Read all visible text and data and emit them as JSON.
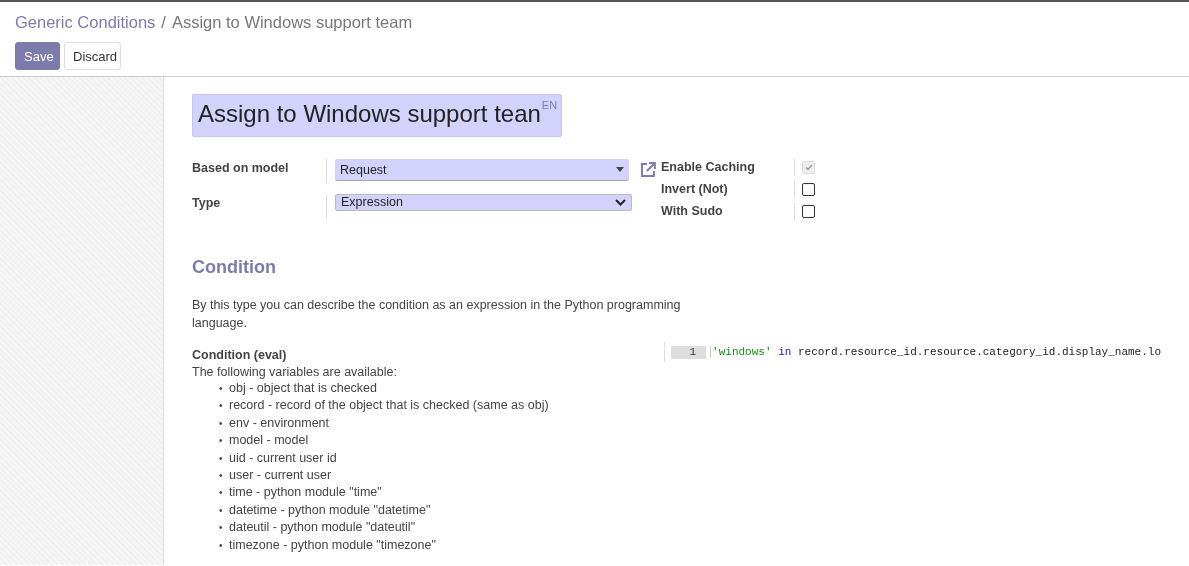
{
  "breadcrumb": {
    "items": [
      {
        "label": "Generic Conditions",
        "kind": "link"
      },
      {
        "label": "Assign to Windows support team",
        "kind": "current"
      }
    ],
    "separator": "/"
  },
  "buttons": [
    {
      "label": "Save",
      "kind": "primary"
    },
    {
      "label": "Discard",
      "kind": "secondary"
    }
  ],
  "title": {
    "value": "Assign to Windows support tean",
    "lang": "EN"
  },
  "fields": [
    {
      "label": "Based on model",
      "kind": "many2one",
      "value": "Request"
    },
    {
      "label": "Type",
      "kind": "select",
      "value": "Expression"
    }
  ],
  "flags": [
    {
      "label": "Enable Caching",
      "checked": true,
      "disabled": true
    },
    {
      "label": "Invert (Not)",
      "checked": false,
      "disabled": false
    },
    {
      "label": "With Sudo",
      "checked": false,
      "disabled": false
    }
  ],
  "condition": {
    "heading": "Condition",
    "description": "By this type you can describe the condition as an expression in the Python programming language.",
    "eval_label": "Condition (eval)",
    "help_intro": "The following variables are available:",
    "bullet": "•",
    "variables": [
      "obj - object that is checked",
      "record - record of the object that is checked (same as obj)",
      "env - environment",
      "model - model",
      "uid - current user id",
      "user - current user",
      "time - python module \"time\"",
      "datetime - python module \"datetime\"",
      "dateutil - python module \"dateutil\"",
      "timezone - python module \"timezone\""
    ],
    "code": {
      "line_number": "1",
      "tokens": [
        {
          "kind": "string",
          "text": "'windows'"
        },
        {
          "kind": "keyword",
          "text": "in"
        },
        {
          "kind": "plain",
          "text": "record.resource_id.resource.category_id.display_name.lo"
        }
      ]
    }
  }
}
